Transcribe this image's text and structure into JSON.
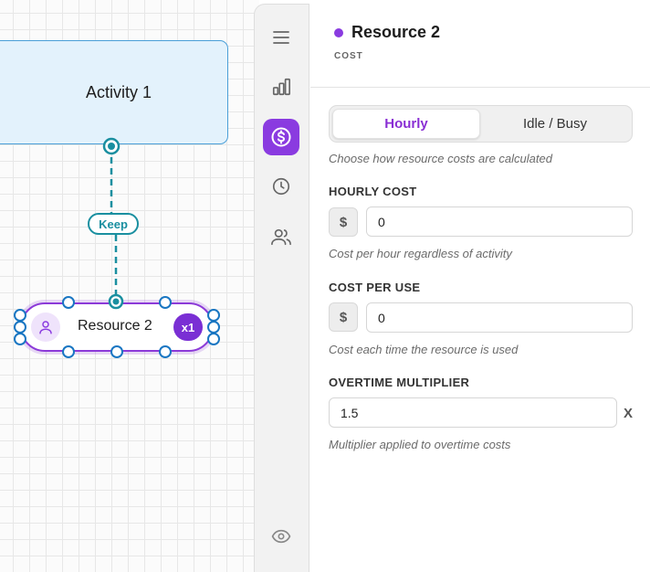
{
  "canvas": {
    "activity_label": "Activity 1",
    "keep_label": "Keep",
    "resource_label": "Resource 2",
    "resource_count": "x1"
  },
  "rail": {
    "items": [
      {
        "icon": "menu-icon",
        "active": false
      },
      {
        "icon": "chart-icon",
        "active": false
      },
      {
        "icon": "dollar-icon",
        "active": true
      },
      {
        "icon": "clock-icon",
        "active": false
      },
      {
        "icon": "users-icon",
        "active": false
      },
      {
        "icon": "eye-icon",
        "active": false
      }
    ]
  },
  "panel": {
    "title": "Resource 2",
    "subtitle": "COST",
    "accent": "#8a3be0",
    "toggle": {
      "options": [
        "Hourly",
        "Idle / Busy"
      ],
      "selected": "Hourly",
      "hint": "Choose how resource costs are calculated"
    },
    "hourly_cost": {
      "label": "HOURLY COST",
      "prefix": "$",
      "value": "0",
      "hint": "Cost per hour regardless of activity"
    },
    "cost_per_use": {
      "label": "COST PER USE",
      "prefix": "$",
      "value": "0",
      "hint": "Cost each time the resource is used"
    },
    "overtime": {
      "label": "OVERTIME MULTIPLIER",
      "value": "1.5",
      "suffix": "X",
      "hint": "Multiplier applied to overtime costs"
    }
  }
}
